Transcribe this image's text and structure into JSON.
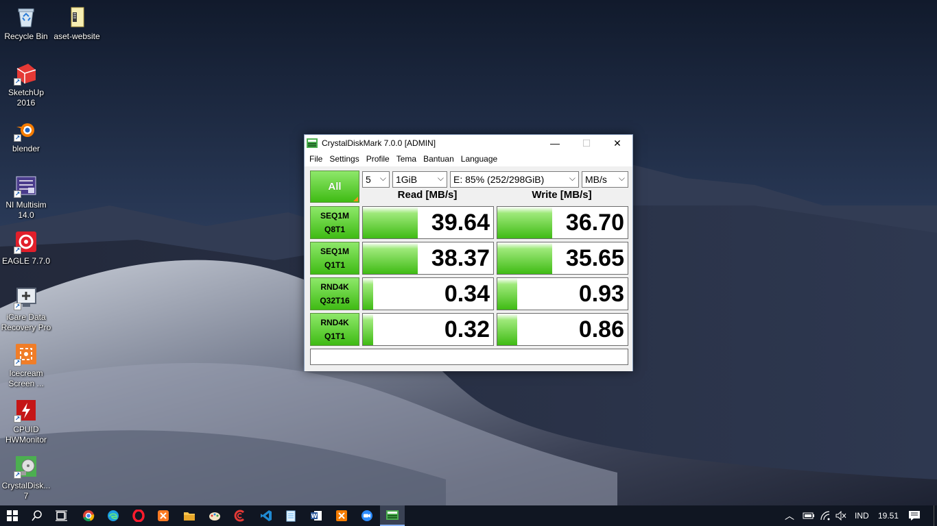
{
  "desktop": {
    "icons": [
      {
        "label": "Recycle Bin",
        "icon": "recycle-bin-icon"
      },
      {
        "label": "aset-website",
        "icon": "folder-icon"
      },
      {
        "label": "SketchUp 2016",
        "icon": "sketchup-icon"
      },
      {
        "label": "blender",
        "icon": "blender-icon"
      },
      {
        "label": "NI Multisim 14.0",
        "icon": "multisim-icon"
      },
      {
        "label": "EAGLE 7.7.0",
        "icon": "eagle-icon"
      },
      {
        "label": "iCare Data Recovery Pro",
        "icon": "icare-icon"
      },
      {
        "label": "Icecream Screen ...",
        "icon": "icecream-icon"
      },
      {
        "label": "CPUID HWMonitor",
        "icon": "hwmonitor-icon"
      },
      {
        "label": "CrystalDisk... 7",
        "icon": "crystaldisk-icon"
      }
    ]
  },
  "window": {
    "title": "CrystalDiskMark 7.0.0  [ADMIN]",
    "controls": {
      "minimize": "—",
      "maximize": "☐",
      "close": "✕"
    },
    "menu": [
      "File",
      "Settings",
      "Profile",
      "Tema",
      "Bantuan",
      "Language"
    ],
    "all_button": "All",
    "options": {
      "count": "5",
      "size": "1GiB",
      "drive": "E: 85% (252/298GiB)",
      "unit": "MB/s"
    },
    "columns": {
      "read": "Read [MB/s]",
      "write": "Write [MB/s]"
    },
    "accent": "#3fbb14",
    "tests": [
      {
        "line1": "SEQ1M",
        "line2": "Q8T1",
        "read": "39.64",
        "write": "36.70",
        "read_frac": 0.42,
        "write_frac": 0.42
      },
      {
        "line1": "SEQ1M",
        "line2": "Q1T1",
        "read": "38.37",
        "write": "35.65",
        "read_frac": 0.42,
        "write_frac": 0.42
      },
      {
        "line1": "RND4K",
        "line2": "Q32T16",
        "read": "0.34",
        "write": "0.93",
        "read_frac": 0.08,
        "write_frac": 0.15
      },
      {
        "line1": "RND4K",
        "line2": "Q1T1",
        "read": "0.32",
        "write": "0.86",
        "read_frac": 0.08,
        "write_frac": 0.15
      }
    ],
    "comment": ""
  },
  "taskbar": {
    "apps": [
      "start-icon",
      "search-icon",
      "task-view-icon",
      "chrome-icon",
      "edge-icon",
      "opera-icon",
      "xampp-icon",
      "file-explorer-icon",
      "paint-icon",
      "ccleaner-icon",
      "vscode-icon",
      "notepad-icon",
      "word-icon",
      "xampp-control-icon",
      "zoom-icon",
      "crystaldiskmark-icon"
    ],
    "tray": {
      "language": "IND",
      "time": "19.51"
    }
  }
}
